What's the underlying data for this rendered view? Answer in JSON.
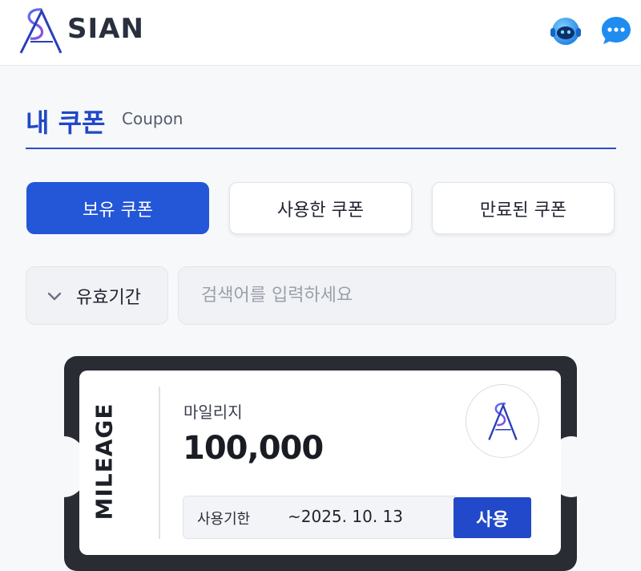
{
  "header": {
    "brand": "SIAN",
    "logo_icon": "sa-monogram-logo",
    "agent_icon": "support-agent-icon",
    "chat_icon": "chat-bubble-icon"
  },
  "page": {
    "title": "내 쿠폰",
    "subtitle": "Coupon"
  },
  "tabs": [
    {
      "label": "보유 쿠폰",
      "active": true
    },
    {
      "label": "사용한 쿠폰",
      "active": false
    },
    {
      "label": "만료된 쿠폰",
      "active": false
    }
  ],
  "filter": {
    "label": "유효기간",
    "icon": "chevron-down-icon"
  },
  "search": {
    "placeholder": "검색어를 입력하세요",
    "value": ""
  },
  "coupons": [
    {
      "type_label": "MILEAGE",
      "category": "마일리지",
      "amount": "100,000",
      "expiry_label": "사용기한",
      "expiry_date": "~2025. 10. 13",
      "use_label": "사용"
    }
  ],
  "colors": {
    "accent": "#2456d8",
    "title": "#2049c8",
    "ticket_frame": "#2a2c33"
  }
}
